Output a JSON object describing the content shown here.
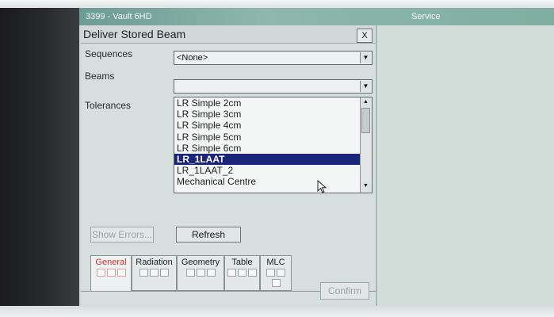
{
  "window": {
    "title_left": "3399 - Vault 6HD",
    "title_right": "Service"
  },
  "dialog": {
    "title": "Deliver Stored Beam",
    "close_label": "X",
    "sequences": {
      "label": "Sequences",
      "value": "<None>"
    },
    "beams": {
      "label": "Beams",
      "value": ""
    },
    "tolerances": {
      "label": "Tolerances"
    },
    "beam_list": {
      "items": [
        {
          "label": "LR Simple 2cm"
        },
        {
          "label": "LR Simple 3cm"
        },
        {
          "label": "LR Simple 4cm"
        },
        {
          "label": "LR Simple 5cm"
        },
        {
          "label": "LR Simple 6cm"
        },
        {
          "label": "LR_1LAAT"
        },
        {
          "label": "LR_1LAAT_2"
        },
        {
          "label": "Mechanical Centre"
        }
      ],
      "selected": "LR_1LAAT"
    },
    "buttons": {
      "show_errors": "Show Errors...",
      "refresh": "Refresh",
      "confirm": "Confirm"
    },
    "tabs": [
      {
        "label": "General",
        "active": true
      },
      {
        "label": "Radiation",
        "active": false
      },
      {
        "label": "Geometry",
        "active": false
      },
      {
        "label": "Table",
        "active": false
      },
      {
        "label": "MLC",
        "active": false
      }
    ]
  },
  "colors": {
    "titlebar": "#7fae9f",
    "selection": "#1b257a",
    "active_tab_text": "#c0392b"
  }
}
